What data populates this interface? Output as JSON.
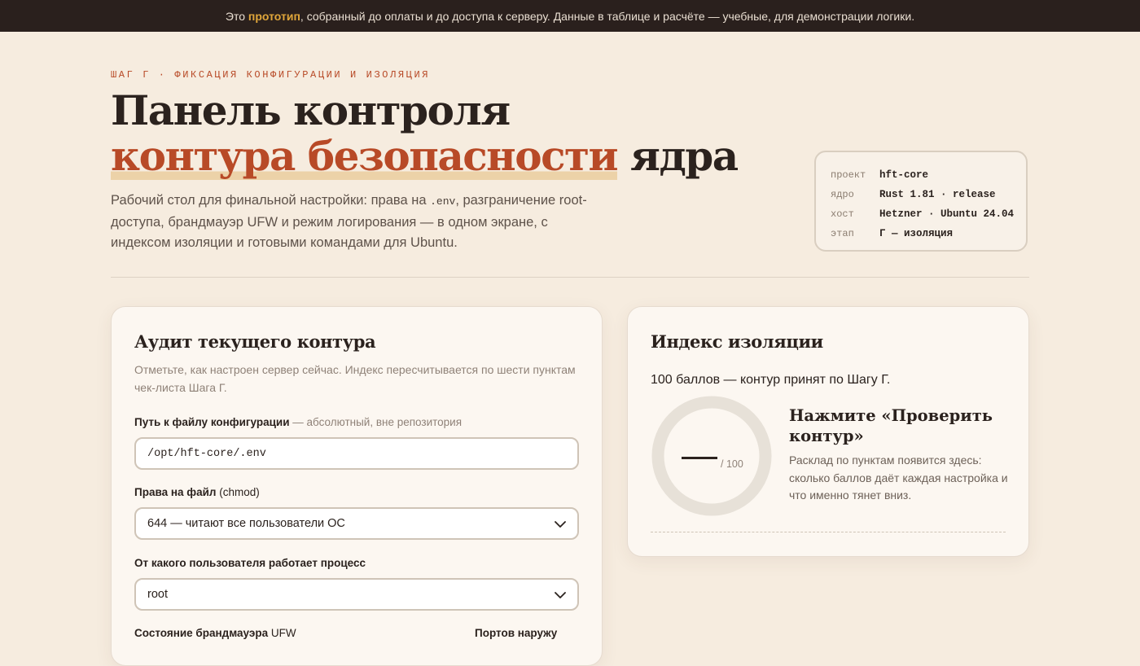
{
  "banner": {
    "prefix": "Это",
    "highlight": "прототип",
    "suffix": ", собранный до оплаты и до доступа к серверу. Данные в таблице и расчёте — учебные, для демонстрации логики."
  },
  "hero": {
    "eyebrow": "ШАГ Г · ФИКСАЦИЯ КОНФИГУРАЦИИ И ИЗОЛЯЦИЯ",
    "title_line1": "Панель контроля",
    "title_accent": "контура безопасности",
    "title_tail": " ядра",
    "lead_before": "Рабочий стол для финальной настройки: права на ",
    "lead_code": ".env",
    "lead_after": ", разграничение root-доступа, брандмауэр UFW и режим логирования — в одном экране, с индексом изоляции и готовыми командами для Ubuntu."
  },
  "meta": [
    {
      "key": "проект",
      "value": "hft-core"
    },
    {
      "key": "ядро",
      "value": "Rust 1.81 · release"
    },
    {
      "key": "хост",
      "value": "Hetzner · Ubuntu 24.04"
    },
    {
      "key": "этап",
      "value": "Г — изоляция"
    }
  ],
  "audit": {
    "title": "Аудит текущего контура",
    "desc": "Отметьте, как настроен сервер сейчас. Индекс пересчитывается по шести пунктам чек-листа Шага Г.",
    "config_path": {
      "label": "Путь к файлу конфигурации",
      "hint": "— абсолютный, вне репозитория",
      "value": "/opt/hft-core/.env"
    },
    "chmod": {
      "label": "Права на файл",
      "paren": "(chmod)",
      "value": "644 — читают все пользователи ОС"
    },
    "process_user": {
      "label": "От какого пользователя работает процесс",
      "value": "root"
    },
    "firewall": {
      "label": "Состояние брандмауэра",
      "label_suffix": "UFW"
    },
    "ports": {
      "label": "Портов наружу"
    }
  },
  "isolation": {
    "title": "Индекс изоляции",
    "score_text": "100 баллов — контур принят по Шагу Г.",
    "max_label": "/ 100",
    "cta_title": "Нажмите «Проверить контур»",
    "cta_desc": "Расклад по пунктам появится здесь: сколько баллов даёт каждая настройка и что именно тянет вниз."
  }
}
